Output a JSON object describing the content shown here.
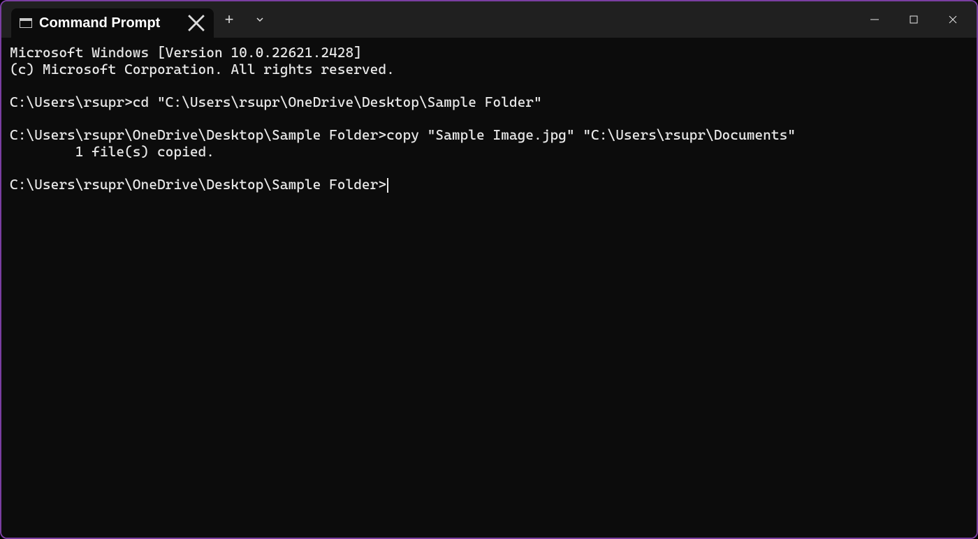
{
  "titlebar": {
    "tab_title": "Command Prompt"
  },
  "terminal": {
    "lines": [
      "Microsoft Windows [Version 10.0.22621.2428]",
      "(c) Microsoft Corporation. All rights reserved.",
      "",
      "C:\\Users\\rsupr>cd \"C:\\Users\\rsupr\\OneDrive\\Desktop\\Sample Folder\"",
      "",
      "C:\\Users\\rsupr\\OneDrive\\Desktop\\Sample Folder>copy \"Sample Image.jpg\" \"C:\\Users\\rsupr\\Documents\"",
      "        1 file(s) copied.",
      ""
    ],
    "current_prompt": "C:\\Users\\rsupr\\OneDrive\\Desktop\\Sample Folder>"
  }
}
